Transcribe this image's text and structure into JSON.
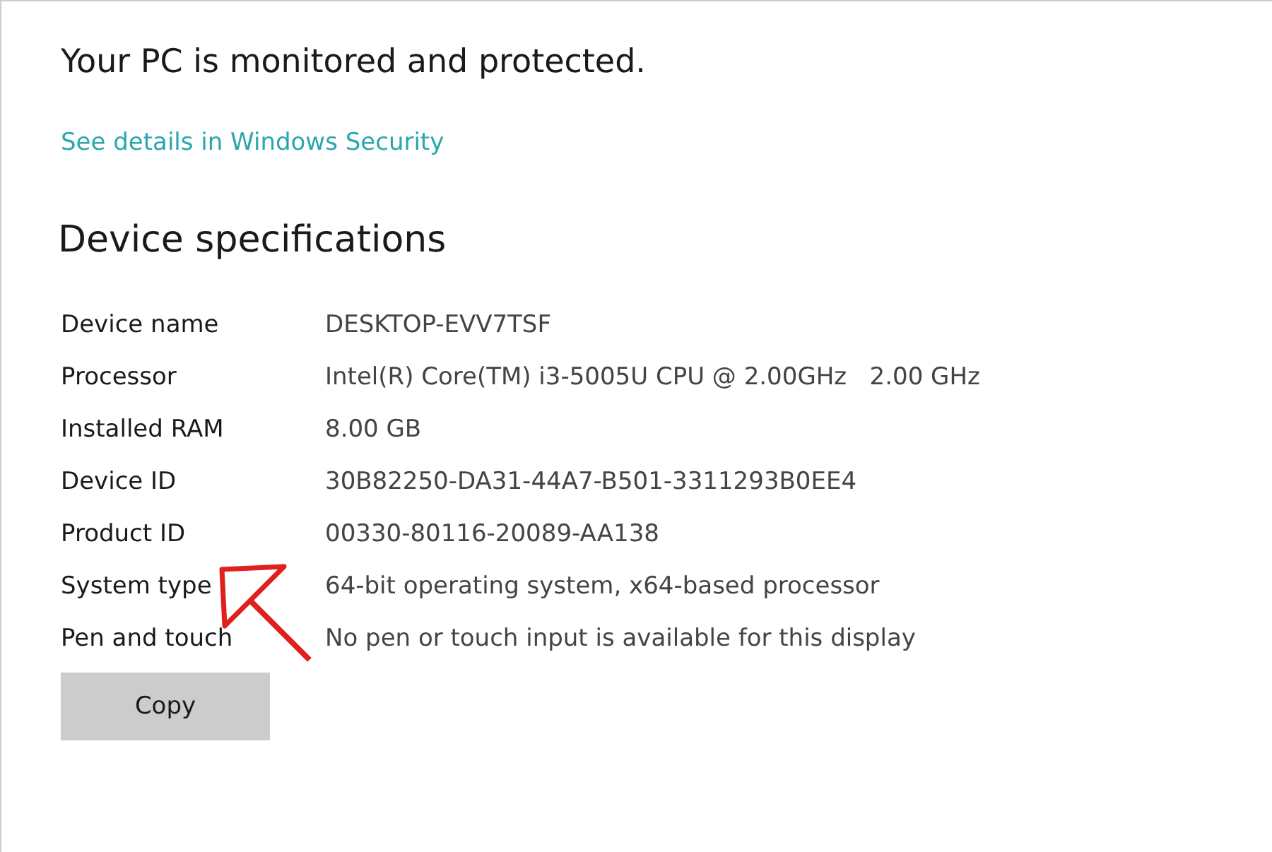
{
  "status": {
    "title": "Your PC is monitored and protected.",
    "link": "See details in Windows Security"
  },
  "specs": {
    "heading": "Device specifications",
    "rows": [
      {
        "label": "Device name",
        "value": "DESKTOP-EVV7TSF"
      },
      {
        "label": "Processor",
        "value": "Intel(R) Core(TM) i3-5005U CPU @ 2.00GHz   2.00 GHz"
      },
      {
        "label": "Installed RAM",
        "value": "8.00 GB"
      },
      {
        "label": "Device ID",
        "value": "30B82250-DA31-44A7-B501-3311293B0EE4"
      },
      {
        "label": "Product ID",
        "value": "00330-80116-20089-AA138"
      },
      {
        "label": "System type",
        "value": "64-bit operating system, x64-based processor"
      },
      {
        "label": "Pen and touch",
        "value": "No pen or touch input is available for this display"
      }
    ]
  },
  "buttons": [
    {
      "label": "Copy"
    }
  ]
}
